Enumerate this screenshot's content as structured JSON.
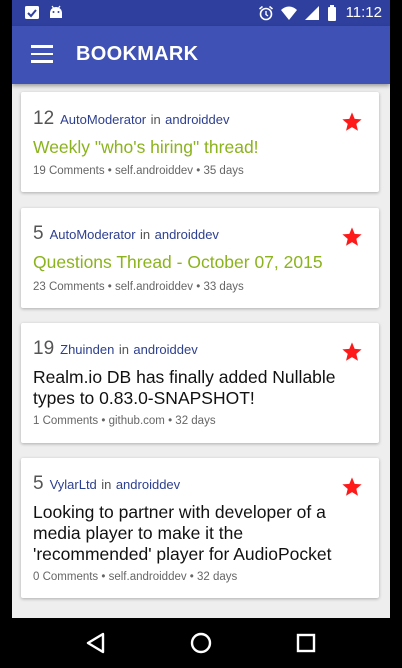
{
  "status_bar": {
    "time": "11:12",
    "left_icons": [
      "notification-box-icon",
      "android-icon"
    ],
    "right_icons": [
      "alarm-icon",
      "wifi-icon",
      "signal-icon",
      "battery-icon"
    ]
  },
  "app_bar": {
    "title": "BOOKMARK",
    "menu_icon": "hamburger-menu-icon",
    "color": "#3f51b5"
  },
  "posts": [
    {
      "score": "12",
      "author": "AutoModerator",
      "in_word": "in",
      "subreddit": "androiddev",
      "title": "Weekly \"who's hiring\" thread!",
      "stickied": true,
      "comments": "19 Comments",
      "domain": "self.androiddev",
      "age": "35 days",
      "bookmarked": true
    },
    {
      "score": "5",
      "author": "AutoModerator",
      "in_word": "in",
      "subreddit": "androiddev",
      "title": "Questions Thread - October 07, 2015",
      "stickied": true,
      "comments": "23 Comments",
      "domain": "self.androiddev",
      "age": "33 days",
      "bookmarked": true
    },
    {
      "score": "19",
      "author": "Zhuinden",
      "in_word": "in",
      "subreddit": "androiddev",
      "title": "Realm.io DB has finally added Nullable types to 0.83.0-SNAPSHOT!",
      "stickied": false,
      "comments": "1 Comments",
      "domain": "github.com",
      "age": "32 days",
      "bookmarked": true
    },
    {
      "score": "5",
      "author": "VylarLtd",
      "in_word": "in",
      "subreddit": "androiddev",
      "title": "Looking to partner with developer of a media player to make it the 'recommended' player for AudioPocket",
      "stickied": false,
      "comments": "0 Comments",
      "domain": "self.androiddev",
      "age": "32 days",
      "bookmarked": true
    }
  ],
  "meta_separator": " • ",
  "colors": {
    "stickied_title": "#8bb31d",
    "star": "#ff1a1a",
    "author_link": "#2d3f8f"
  },
  "nav_bar": {
    "back": "back-icon",
    "home": "home-icon",
    "recents": "recents-icon"
  }
}
